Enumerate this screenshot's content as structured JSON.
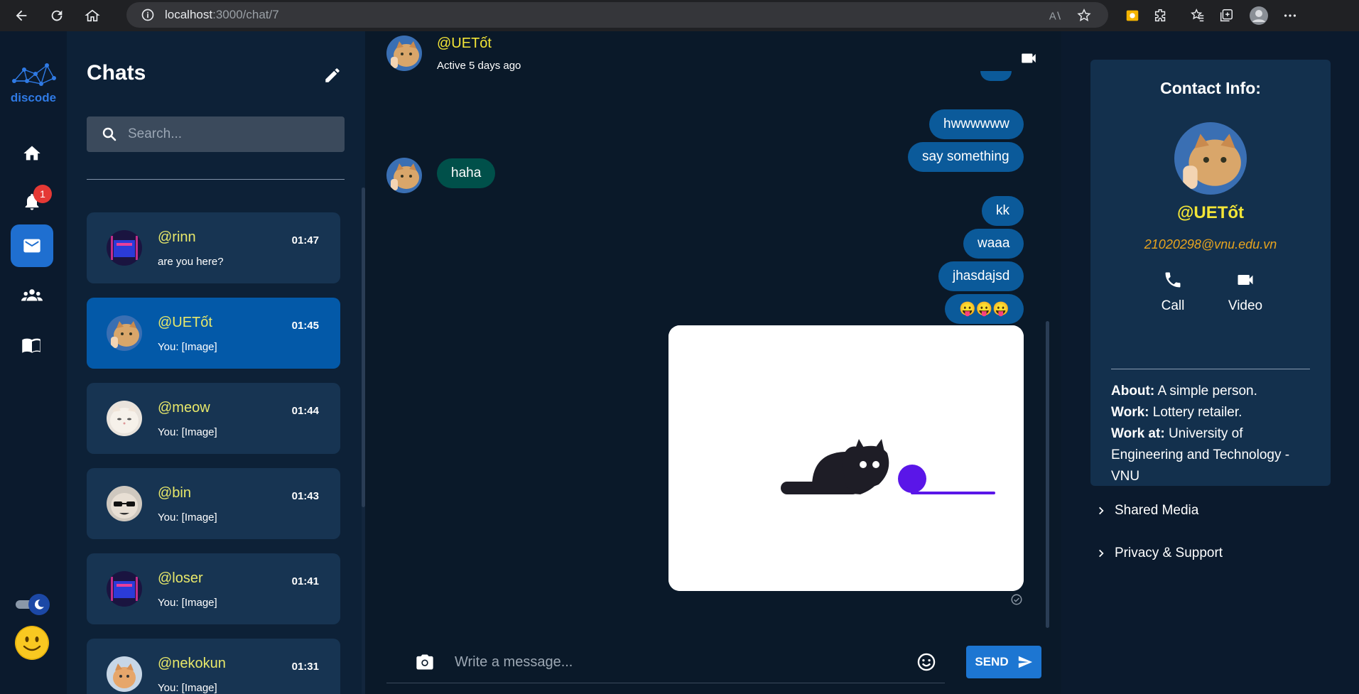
{
  "browser": {
    "url_host": "localhost",
    "url_rest": ":3000/chat/7"
  },
  "rail": {
    "logo_text": "discode",
    "notification_count": "1"
  },
  "chat_list": {
    "title": "Chats",
    "search_placeholder": "Search...",
    "items": [
      {
        "name": "@rinn",
        "time": "01:47",
        "preview": "are you here?"
      },
      {
        "name": "@UETốt",
        "time": "01:45",
        "preview": "You: [Image]"
      },
      {
        "name": "@meow",
        "time": "01:44",
        "preview": "You: [Image]"
      },
      {
        "name": "@bin",
        "time": "01:43",
        "preview": "You: [Image]"
      },
      {
        "name": "@loser",
        "time": "01:41",
        "preview": "You: [Image]"
      },
      {
        "name": "@nekokun",
        "time": "01:31",
        "preview": "You: [Image]"
      }
    ]
  },
  "conversation": {
    "name": "@UETốt",
    "status": "Active 5 days ago",
    "messages": [
      {
        "text": "hwwwwww",
        "dir": "out"
      },
      {
        "text": "say something",
        "dir": "out"
      },
      {
        "text": "haha",
        "dir": "in"
      },
      {
        "text": "kk",
        "dir": "out"
      },
      {
        "text": "waaa",
        "dir": "out"
      },
      {
        "text": "jhasdajsd",
        "dir": "out"
      },
      {
        "text": "😛😛😛",
        "dir": "out"
      }
    ],
    "composer_placeholder": "Write a message...",
    "send_label": "SEND"
  },
  "contact": {
    "title": "Contact Info:",
    "name": "@UETốt",
    "email": "21020298@vnu.edu.vn",
    "call_label": "Call",
    "video_label": "Video",
    "about_label": "About:",
    "about": "A simple person.",
    "work_label": "Work:",
    "work": "Lottery retailer.",
    "work_at_label": "Work at:",
    "work_at": "University of Engineering and Technology - VNU",
    "shared_media": "Shared Media",
    "privacy": "Privacy & Support"
  },
  "colors": {
    "accent": "#1f6fd0",
    "name_yellow": "#f3e537",
    "email_orange": "#e8a41e",
    "outgoing_bubble": "#0b5a9a",
    "incoming_bubble": "#00504a"
  }
}
